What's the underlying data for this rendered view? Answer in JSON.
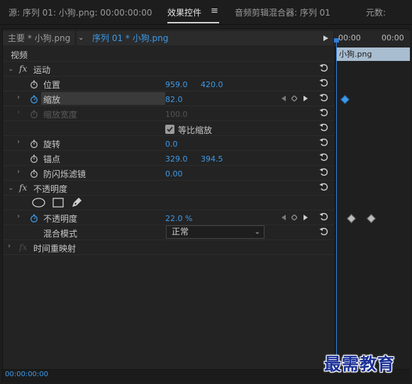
{
  "tabs": {
    "source": "源: 序列 01: 小狗.png: 00:00:00:00",
    "effect_controls": "效果控件",
    "audio_mixer": "音频剪辑混合器: 序列 01",
    "metadata": "元数:"
  },
  "header": {
    "master": "主要 * 小狗.png",
    "sequence": "序列 01 * 小狗.png"
  },
  "timeline": {
    "tc_start": "00:00",
    "tc_end": "00:00",
    "clip_name": "小狗.png"
  },
  "section": {
    "video": "视频"
  },
  "motion": {
    "name": "运动",
    "position": {
      "label": "位置",
      "x": "959.0",
      "y": "420.0"
    },
    "scale": {
      "label": "缩放",
      "value": "82.0"
    },
    "scale_width": {
      "label": "缩放宽度",
      "value": "100.0"
    },
    "uniform_scale": {
      "label": "等比缩放",
      "checked": true
    },
    "rotation": {
      "label": "旋转",
      "value": "0.0"
    },
    "anchor": {
      "label": "锚点",
      "x": "329.0",
      "y": "394.5"
    },
    "anti_flicker": {
      "label": "防闪烁滤镜",
      "value": "0.00"
    }
  },
  "opacity": {
    "name": "不透明度",
    "opacity": {
      "label": "不透明度",
      "value": "22.0 %"
    },
    "blend_mode": {
      "label": "混合模式",
      "value": "正常"
    }
  },
  "time_remap": {
    "name": "时间重映射"
  },
  "footer": {
    "timecode": "00:00:00:00"
  },
  "watermark": "最需教育",
  "colors": {
    "accent": "#3d9ae8",
    "clip": "#a9bdd0",
    "panel": "#232323",
    "watermark": "#1a2f96"
  },
  "icons": [
    "hamburger-menu-icon",
    "play-arrow-icon",
    "chevron-down-icon",
    "fx-icon",
    "stopwatch-icon",
    "reset-icon",
    "keyframe-prev-icon",
    "keyframe-add-icon",
    "keyframe-next-icon",
    "ellipse-mask-icon",
    "rectangle-mask-icon",
    "pen-mask-icon",
    "checkbox-icon"
  ]
}
